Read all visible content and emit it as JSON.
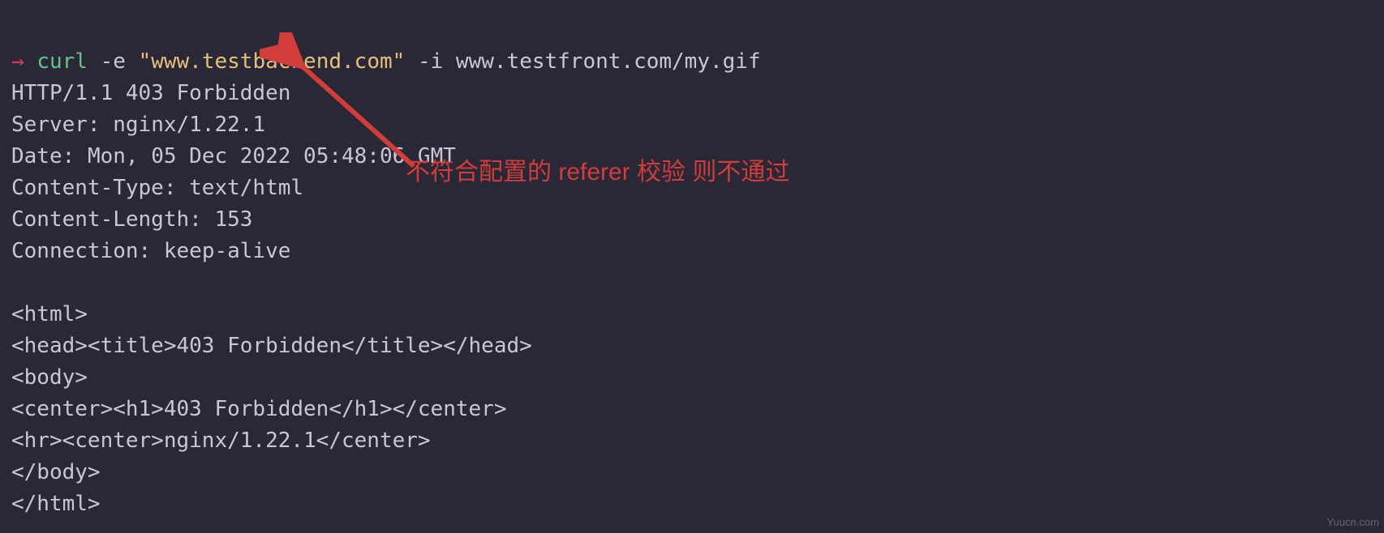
{
  "prompt": {
    "arrow": "→"
  },
  "command": {
    "name": "curl",
    "flag1": "-e",
    "argstr": "\"www.testbackend.com\"",
    "flag2": "-i",
    "url": "www.testfront.com/my.gif"
  },
  "response": {
    "status_line": "HTTP/1.1 403 Forbidden",
    "headers": [
      {
        "name": "Server",
        "value": "nginx/1.22.1"
      },
      {
        "name": "Date",
        "value": "Mon, 05 Dec 2022 05:48:06 GMT"
      },
      {
        "name": "Content-Type",
        "value": "text/html"
      },
      {
        "name": "Content-Length",
        "value": "153"
      },
      {
        "name": "Connection",
        "value": "keep-alive"
      }
    ],
    "body_lines": [
      "<html>",
      "<head><title>403 Forbidden</title></head>",
      "<body>",
      "<center><h1>403 Forbidden</h1></center>",
      "<hr><center>nginx/1.22.1</center>",
      "</body>",
      "</html>"
    ]
  },
  "annotation": {
    "text": "不符合配置的 referer 校验 则不通过"
  },
  "watermark": "Yuucn.com"
}
